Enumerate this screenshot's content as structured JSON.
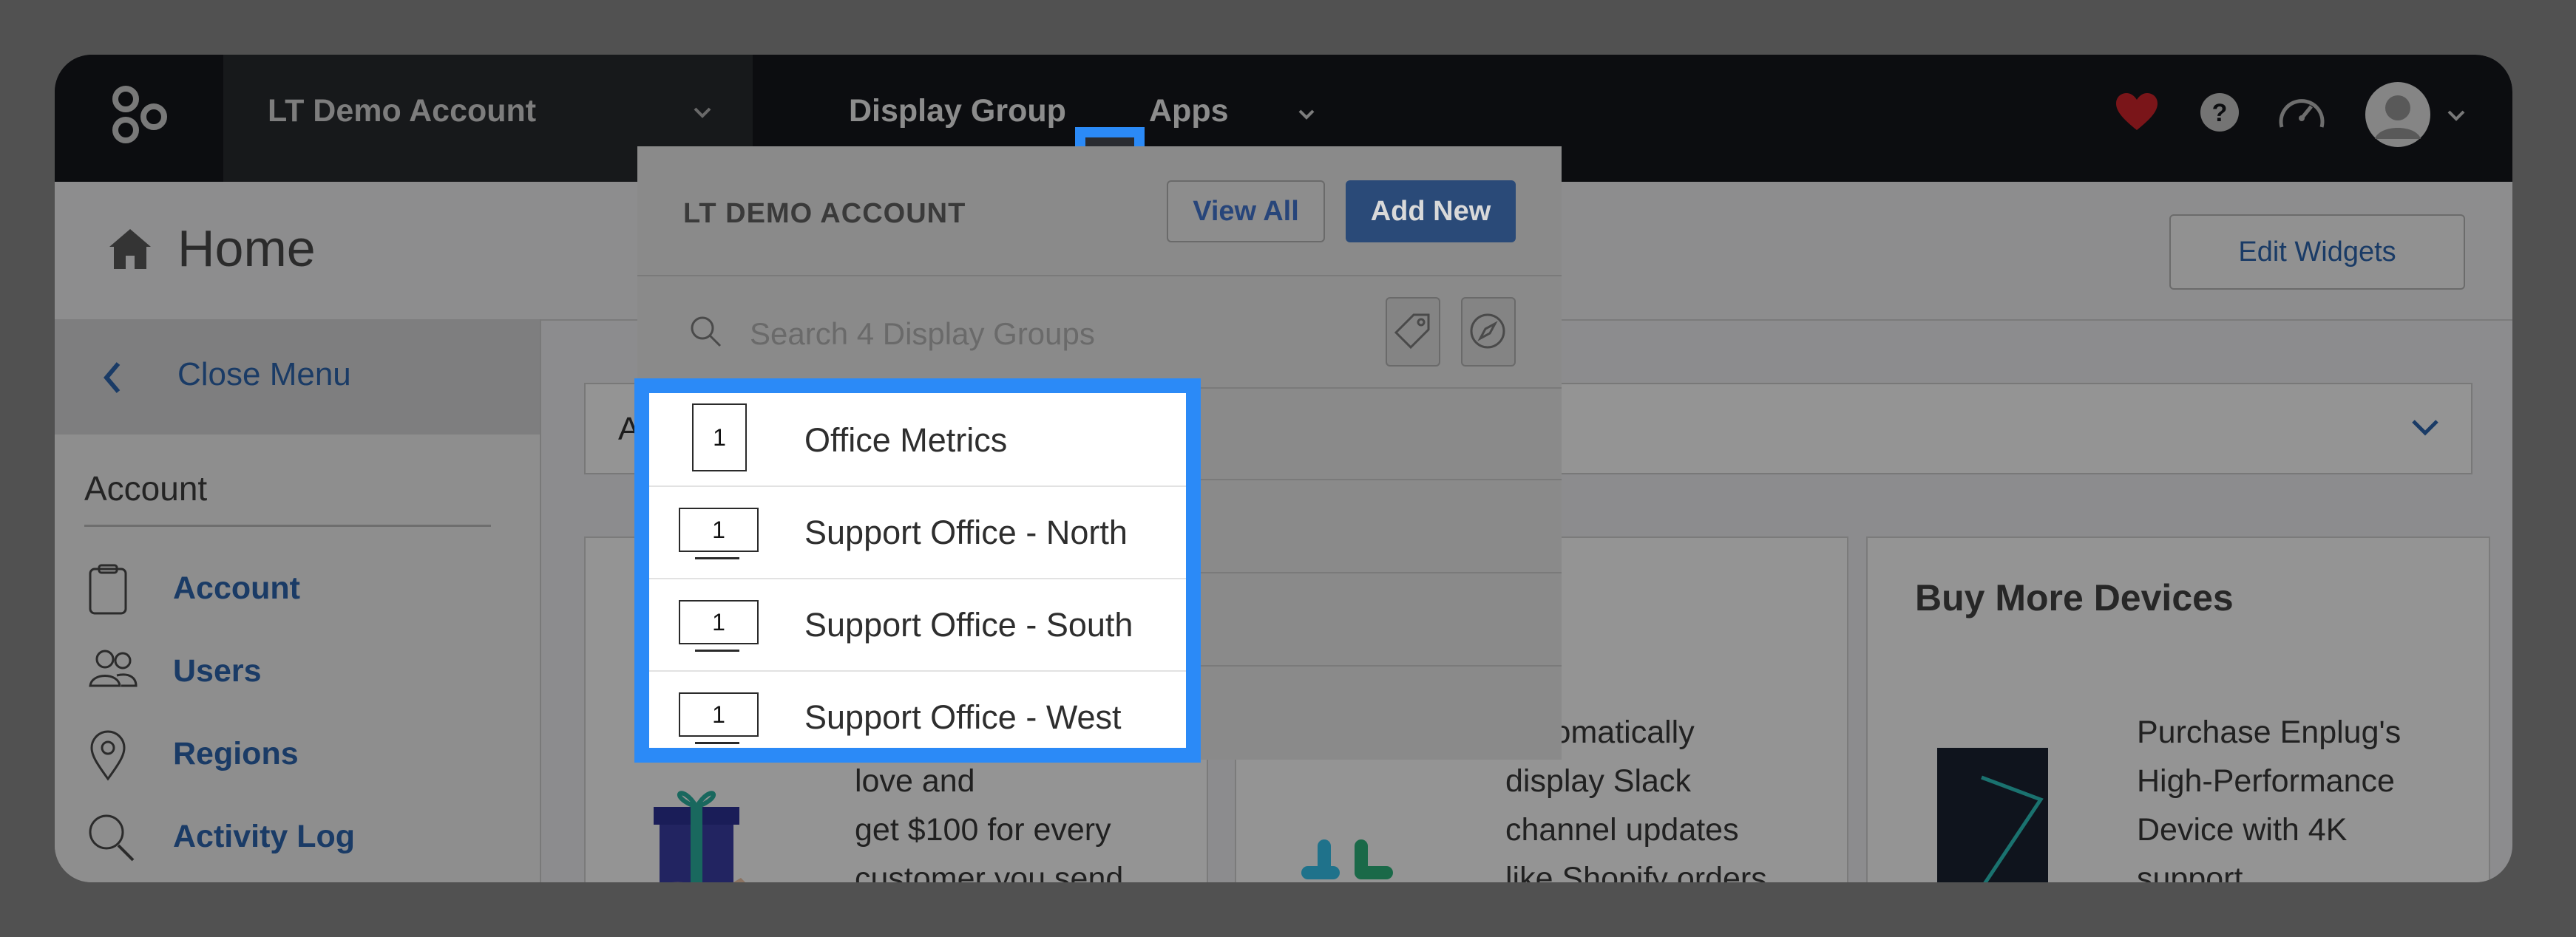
{
  "topnav": {
    "account_name": "LT Demo Account",
    "display_group_label": "Display Group",
    "apps_label": "Apps"
  },
  "page": {
    "title": "Home",
    "edit_widgets_label": "Edit Widgets"
  },
  "sidebar": {
    "close_menu_label": "Close Menu",
    "section_heading": "Account",
    "items": [
      {
        "label": "Account",
        "icon": "clipboard-icon"
      },
      {
        "label": "Users",
        "icon": "users-icon"
      },
      {
        "label": "Regions",
        "icon": "map-pin-icon"
      },
      {
        "label": "Activity Log",
        "icon": "search-icon"
      }
    ]
  },
  "main": {
    "select_value_initial": "A",
    "cards": [
      {
        "lines": [
          "love and",
          "get $100 for every",
          "customer you send"
        ]
      },
      {
        "lines": [
          "Automatically",
          "display Slack",
          "channel updates",
          "like Shopify orders"
        ]
      },
      {
        "title": "Buy More Devices",
        "lines": [
          "Purchase Enplug's",
          "High-Performance",
          "Device with 4K",
          "support"
        ]
      }
    ]
  },
  "dropdown": {
    "account_heading": "LT DEMO ACCOUNT",
    "view_all_label": "View All",
    "add_new_label": "Add New",
    "search_placeholder": "Search 4 Display Groups",
    "groups": [
      {
        "name": "Office Metrics",
        "count": "1",
        "orientation": "portrait"
      },
      {
        "name": "Support Office - North",
        "count": "1",
        "orientation": "landscape"
      },
      {
        "name": "Support Office - South",
        "count": "1",
        "orientation": "landscape"
      },
      {
        "name": "Support Office - West",
        "count": "1",
        "orientation": "landscape"
      }
    ]
  },
  "colors": {
    "highlight": "#2b8af7",
    "accent": "#2d67b0",
    "nav_bg": "#15171c",
    "heart": "#d3252c"
  }
}
